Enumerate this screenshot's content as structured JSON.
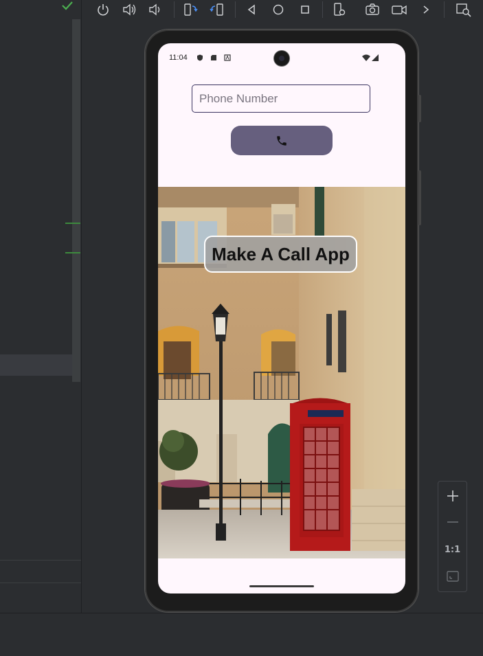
{
  "toolbar": {
    "icons": [
      "power-icon",
      "volume-up-icon",
      "volume-down-icon",
      "rotate-left-icon",
      "rotate-right-icon",
      "back-icon",
      "home-icon",
      "overview-icon",
      "device-settings-icon",
      "camera-icon",
      "screen-record-icon",
      "more-icon",
      "zoom-window-icon"
    ]
  },
  "zoom_controls": {
    "one_to_one": "1:1"
  },
  "device": {
    "status_bar": {
      "time": "11:04"
    },
    "phone_input": {
      "placeholder": "Phone Number",
      "value": ""
    },
    "call_button": {
      "icon": "phone-icon"
    },
    "banner": {
      "title": "Make A Call App"
    }
  },
  "colors": {
    "ide_bg": "#2b2d30",
    "screen_bg": "#fff7fd",
    "call_button": "#665f7e",
    "input_border": "#3a3360",
    "phone_booth_red": "#b51a1a"
  }
}
